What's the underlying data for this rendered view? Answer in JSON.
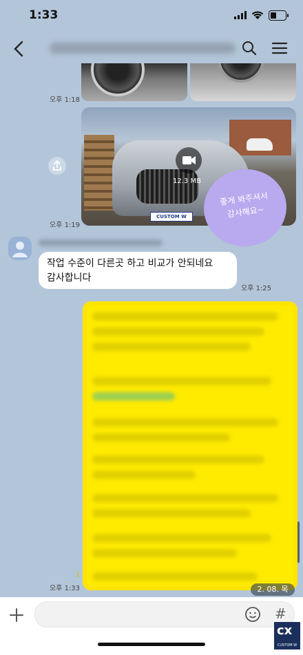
{
  "status": {
    "time": "1:33"
  },
  "header": {
    "back_icon": "chevron-left-icon",
    "search_icon": "search-icon",
    "menu_icon": "hamburger-icon"
  },
  "messages": {
    "photo_time": "오후 1:18",
    "video_time": "오후 1:19",
    "video_size": "12.3 MB",
    "sticker_text": "좋게 봐주셔서\n감사해요~",
    "incoming_text": "작업 수준이 다른곳 하고 비교가 안되네요\n감사합니다",
    "incoming_time": "오후 1:25",
    "outgoing_time": "오후 1:33",
    "unread_count": "1",
    "plate_text": "CUSTOM W"
  },
  "date_chip": "2. 08. 목",
  "bottom": {
    "plus_icon": "plus-icon",
    "emoji_icon": "emoji-icon",
    "hash_label": "#"
  },
  "logo": {
    "mark": "cx",
    "sub": "CUSTOM W"
  },
  "colors": {
    "background": "#b3c5d9",
    "my_bubble": "#ffeb00",
    "sticker": "#b9a9ef"
  }
}
